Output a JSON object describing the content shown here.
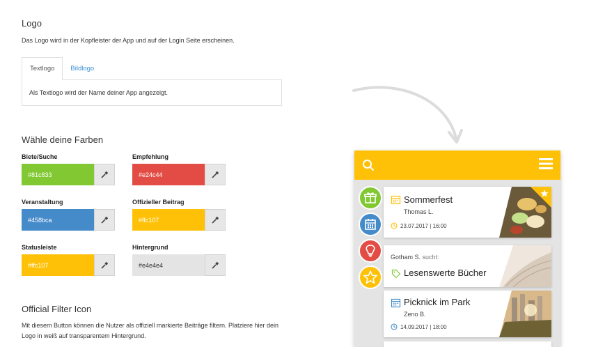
{
  "logo_section": {
    "heading": "Logo",
    "description": "Das Logo wird in der Kopfleister der App und auf der Login Seite erscheinen.",
    "tabs": [
      {
        "label": "Textlogo",
        "active": true
      },
      {
        "label": "Bildlogo",
        "active": false
      }
    ],
    "panel_text": "Als Textlogo wird der Name deiner App angezeigt."
  },
  "colors_section": {
    "heading": "Wähle deine Farben",
    "fields": [
      {
        "label": "Biete/Suche",
        "value": "#81c833",
        "color": "#81c833",
        "text_color": "#ffffff"
      },
      {
        "label": "Empfehlung",
        "value": "#e24c44",
        "color": "#e24c44",
        "text_color": "#ffffff"
      },
      {
        "label": "Veranstaltung",
        "value": "#458bca",
        "color": "#458bca",
        "text_color": "#ffffff"
      },
      {
        "label": "Offizieller Beitrag",
        "value": "#ffc107",
        "color": "#ffc107",
        "text_color": "#ffffff"
      },
      {
        "label": "Statusleiste",
        "value": "#ffc107",
        "color": "#ffc107",
        "text_color": "#ffffff"
      },
      {
        "label": "Hintergrund",
        "value": "#e4e4e4",
        "color": "#e4e4e4",
        "text_color": "#333333"
      }
    ]
  },
  "filter_section": {
    "heading": "Official Filter Icon",
    "description_line1": "Mit diesem Button können die Nutzer als offiziell markierte Beiträge filtern. Platziere hier dein",
    "description_line2": "Logo in weiß auf transparentem Hintergrund."
  },
  "preview": {
    "topbar_color": "#ffc107",
    "background_color": "#e4e4e4",
    "icons": [
      "search-icon",
      "menu-icon",
      "gift-icon",
      "calendar-icon",
      "lightbulb-icon",
      "star-icon"
    ],
    "cards": [
      {
        "title": "Sommerfest",
        "subtitle": "Thomas L.",
        "meta": "23.07.2017 | 16:00"
      },
      {
        "author": "Gotham S.",
        "action": "sucht:",
        "title": "Lesenswerte Bücher"
      },
      {
        "title": "Picknick im Park",
        "subtitle": "Zeno B.",
        "meta": "14.09.2017 | 18:00"
      }
    ]
  }
}
